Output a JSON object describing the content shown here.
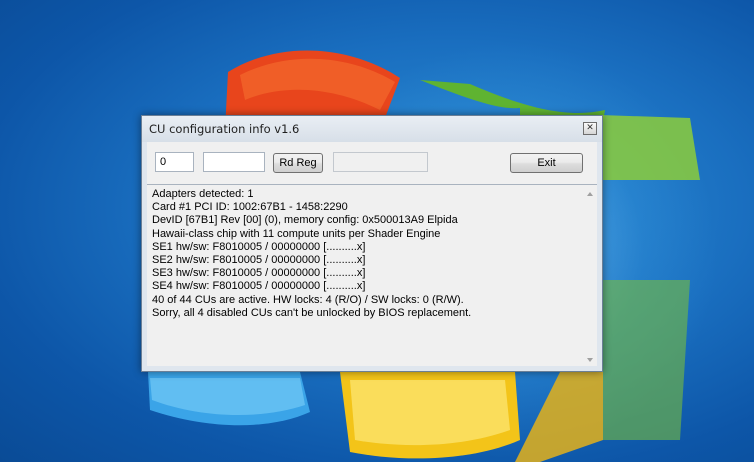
{
  "window": {
    "title": "CU configuration info v1.6",
    "close_glyph": "✕"
  },
  "toolbar": {
    "adapter_index_value": "0",
    "register_value": "",
    "rd_reg_label": "Rd Reg",
    "result_value": "",
    "exit_label": "Exit"
  },
  "output": {
    "lines": [
      "Adapters detected: 1",
      "Card #1 PCI ID: 1002:67B1 - 1458:2290",
      "DevID [67B1] Rev [00] (0), memory config: 0x500013A9 Elpida",
      "Hawaii-class chip with 11 compute units per Shader Engine",
      "SE1 hw/sw: F8010005 / 00000000 [..........x]",
      "SE2 hw/sw: F8010005 / 00000000 [..........x]",
      "SE3 hw/sw: F8010005 / 00000000 [..........x]",
      "SE4 hw/sw: F8010005 / 00000000 [..........x]",
      "40 of 44 CUs are active. HW locks: 4 (R/O) / SW locks: 0 (R/W).",
      "Sorry, all 4 disabled CUs can't be unlocked by BIOS replacement."
    ]
  },
  "colors": {
    "desktop": "#1a6fc0",
    "window_face": "#f0f0f0"
  }
}
